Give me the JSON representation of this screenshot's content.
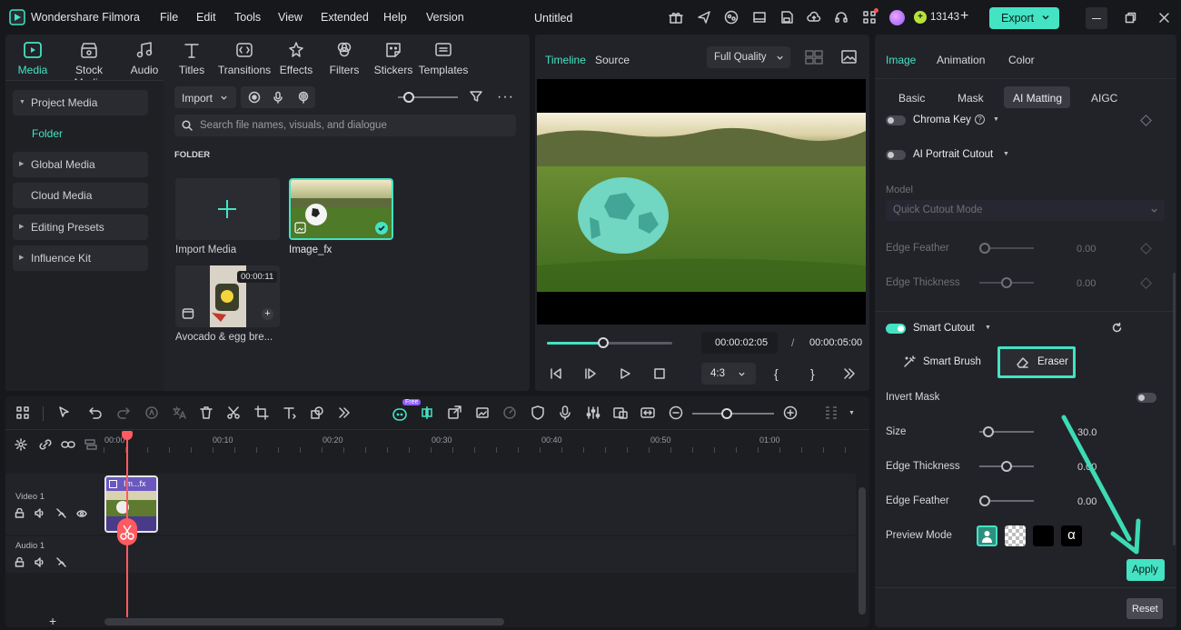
{
  "app": {
    "name": "Wondershare Filmora",
    "project_title": "Untitled"
  },
  "menu": [
    "File",
    "Edit",
    "Tools",
    "View",
    "Extended",
    "Help",
    "Version"
  ],
  "account": {
    "credits": "13143",
    "export_label": "Export"
  },
  "toolbar": [
    "Media",
    "Stock Media",
    "Audio",
    "Titles",
    "Transitions",
    "Effects",
    "Filters",
    "Stickers",
    "Templates"
  ],
  "sidebar": {
    "items": [
      {
        "label": "Project Media",
        "expanded": true
      },
      {
        "label": "Folder",
        "active": true
      },
      {
        "label": "Global Media"
      },
      {
        "label": "Cloud Media"
      },
      {
        "label": "Editing Presets"
      },
      {
        "label": "Influence Kit"
      }
    ]
  },
  "media": {
    "import_label": "Import",
    "search_placeholder": "Search file names, visuals, and dialogue",
    "folder_header": "FOLDER",
    "tiles": [
      {
        "label": "Import Media"
      },
      {
        "label": "Image_fx"
      },
      {
        "label": "Avocado & egg bre...",
        "duration": "00:00:11"
      }
    ]
  },
  "preview": {
    "tabs": [
      "Timeline",
      "Source"
    ],
    "quality": "Full Quality",
    "current_time": "00:00:02:05",
    "separator": "/",
    "total_time": "00:00:05:00",
    "aspect": "4:3",
    "progress": 0.45
  },
  "properties": {
    "top_tabs": [
      "Image",
      "Animation",
      "Color"
    ],
    "sub_tabs": [
      "Basic",
      "Mask",
      "AI Matting",
      "AIGC"
    ],
    "chroma_key": "Chroma Key",
    "ai_portrait": "AI Portrait Cutout",
    "model_label": "Model",
    "model_value": "Quick Cutout Mode",
    "edge_feather_label": "Edge Feather",
    "edge_feather_value": "0.00",
    "edge_thickness_label": "Edge Thickness",
    "edge_thickness_value": "0.00",
    "smart_cutout": "Smart Cutout",
    "smart_brush": "Smart Brush",
    "eraser": "Eraser",
    "invert_mask": "Invert Mask",
    "size_label": "Size",
    "size_value": "30.0",
    "sc_edge_thickness_label": "Edge Thickness",
    "sc_edge_thickness_value": "0.00",
    "sc_edge_feather_label": "Edge Feather",
    "sc_edge_feather_value": "0.00",
    "preview_mode_label": "Preview Mode",
    "apply_label": "Apply",
    "reset_label": "Reset"
  },
  "timeline": {
    "ruler": [
      "00:00",
      "00:10",
      "00:20",
      "00:30",
      "00:40",
      "00:50",
      "01:00"
    ],
    "free_badge": "Free",
    "tracks": [
      {
        "label": "Video 1"
      },
      {
        "label": "Audio 1"
      }
    ],
    "clip_label": "Im...fx"
  },
  "colors": {
    "accent": "#43e3c4",
    "arrow": "#3ddbb4",
    "playhead": "#ff5a5f"
  }
}
